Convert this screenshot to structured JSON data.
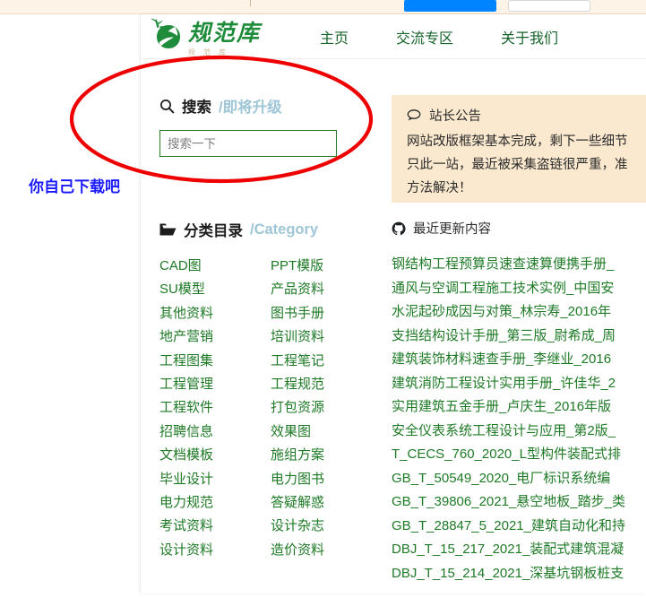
{
  "browser_strip": {
    "blue_button_color": "#0084ff",
    "white_box_color": "#ffffff",
    "strip_color": "#fdf3e7"
  },
  "header": {
    "brand_name": "规范库",
    "brand_sub": "规范库",
    "logo_icon": "leaf-logo-icon",
    "nav": [
      {
        "label": "主页",
        "name": "nav-home"
      },
      {
        "label": "交流专区",
        "name": "nav-forum"
      },
      {
        "label": "关于我们",
        "name": "nav-about"
      }
    ],
    "nav_color": "#17632b"
  },
  "search": {
    "icon": "search-icon",
    "title": "搜索",
    "subtitle": "/即将升级",
    "placeholder": "搜索一下",
    "value": "",
    "border_color": "#2b7a2b"
  },
  "category": {
    "icon": "folder-open-icon",
    "title": "分类目录",
    "subtitle": "/Category",
    "items": [
      "CAD图",
      "PPT模版",
      "SU模型",
      "产品资料",
      "其他资料",
      "图书手册",
      "地产营销",
      "培训资料",
      "工程图集",
      "工程笔记",
      "工程管理",
      "工程规范",
      "工程软件",
      "打包资源",
      "招聘信息",
      "效果图",
      "文档模板",
      "施组方案",
      "毕业设计",
      "电力图书",
      "电力规范",
      "答疑解惑",
      "考试资料",
      "设计杂志",
      "设计资料",
      "造价资料"
    ],
    "link_color": "#1e7a26"
  },
  "announcement": {
    "icon": "speech-bubble-icon",
    "title": "站长公告",
    "lines": [
      "网站改版框架基本完成，剩下一些细节",
      "只此一站，最近被采集盗链很严重，准",
      "方法解决！"
    ],
    "background": "#fbe9cf"
  },
  "updates": {
    "icon": "github-mark-icon",
    "title": "最近更新内容",
    "items": [
      "钢结构工程预算员速查速算便携手册_",
      "通风与空调工程施工技术实例_中国安",
      "水泥起砂成因与对策_林宗寿_2016年",
      "支挡结构设计手册_第三版_尉希成_周",
      "建筑装饰材料速查手册_李继业_2016",
      "建筑消防工程设计实用手册_许佳华_2",
      "实用建筑五金手册_卢庆生_2016年版",
      "安全仪表系统工程设计与应用_第2版_",
      "T_CECS_760_2020_L型构件装配式排",
      "GB_T_50549_2020_电厂标识系统编",
      "GB_T_39806_2021_悬空地板_踏步_类",
      "GB_T_28847_5_2021_建筑自动化和持",
      "DBJ_T_15_217_2021_装配式建筑混凝",
      "DBJ_T_15_214_2021_深基坑钢板桩支"
    ],
    "link_color": "#1e7a26"
  },
  "annotations": {
    "ellipse_color": "#ee0000",
    "note_text": "你自己下载吧",
    "note_color": "#1a1aff"
  }
}
